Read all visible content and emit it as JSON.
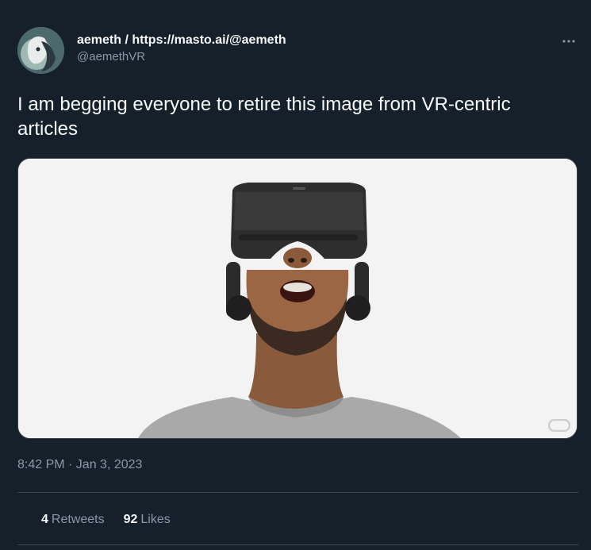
{
  "user": {
    "display_name": "aemeth / https://masto.ai/@aemeth",
    "handle": "@aemethVR",
    "avatar_icon": "avatar-image"
  },
  "tweet": {
    "text": "I am begging everyone to retire this image from VR-centric articles",
    "timestamp": "8:42 PM · Jan 3, 2023"
  },
  "stats": {
    "retweets_count": "4",
    "retweets_label": "Retweets",
    "likes_count": "92",
    "likes_label": "Likes"
  },
  "menu": {
    "more_icon": "more-horizontal-icon"
  },
  "colors": {
    "background": "#15202b",
    "text_primary": "#f7f9f9",
    "text_secondary": "#8b98a5",
    "border": "#38444d"
  }
}
